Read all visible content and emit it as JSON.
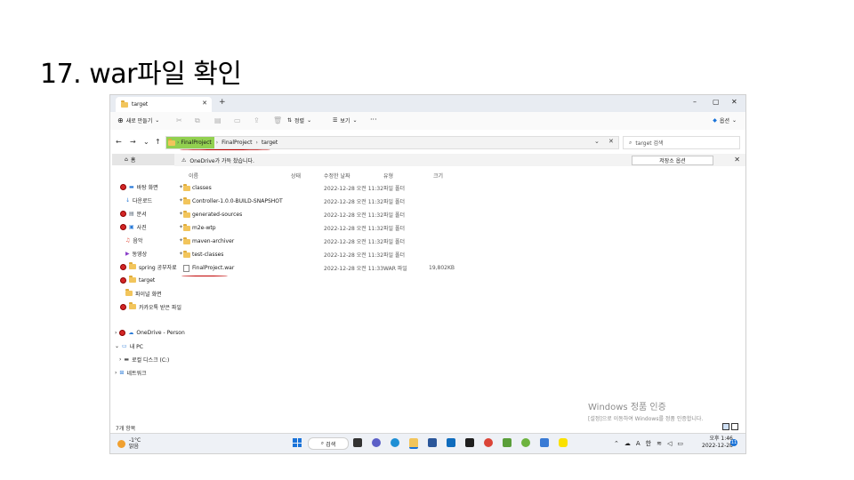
{
  "slide": {
    "title": "17. war파일 확인"
  },
  "window": {
    "tab_title": "target",
    "controls": {
      "minimize": "–",
      "maximize": "▢",
      "close": "✕"
    }
  },
  "toolbar": {
    "new_label": "새로 만들기",
    "sort_label": "정렬",
    "view_label": "보기",
    "more_label": "···",
    "options_label": "옵션"
  },
  "address": {
    "crumbs": [
      "FinalProject",
      "FinalProject",
      "target"
    ],
    "search_placeholder": "target 검색"
  },
  "sidebar": {
    "home": "홈",
    "pinned": [
      {
        "label": "바탕 화면",
        "icon": "desktop-icon"
      },
      {
        "label": "다운로드",
        "icon": "download-icon"
      },
      {
        "label": "문서",
        "icon": "document-icon"
      },
      {
        "label": "사진",
        "icon": "picture-icon"
      },
      {
        "label": "음악",
        "icon": "music-icon"
      },
      {
        "label": "동영상",
        "icon": "video-icon"
      },
      {
        "label": "spring 공부자료",
        "icon": "folder-icon"
      },
      {
        "label": "target",
        "icon": "folder-icon"
      },
      {
        "label": "파이널 화면",
        "icon": "folder-icon"
      },
      {
        "label": "카카오톡 받은 파일",
        "icon": "folder-icon"
      }
    ],
    "tree": [
      {
        "label": "OneDrive - Person"
      },
      {
        "label": "내 PC"
      },
      {
        "label": "로컬 디스크 (C:)"
      },
      {
        "label": "네트워크"
      }
    ]
  },
  "onedrive_bar": {
    "message": "OneDrive가 가득 찼습니다.",
    "button": "저장소 옵션"
  },
  "columns": {
    "name": "이름",
    "status": "상태",
    "modified": "수정한 날짜",
    "type": "유형",
    "size": "크기"
  },
  "files": [
    {
      "name": "classes",
      "date": "2022-12-28 오전 11:32",
      "type": "파일 폴더",
      "size": "",
      "kind": "folder"
    },
    {
      "name": "Controller-1.0.0-BUILD-SNAPSHOT",
      "date": "2022-12-28 오전 11:32",
      "type": "파일 폴더",
      "size": "",
      "kind": "folder"
    },
    {
      "name": "generated-sources",
      "date": "2022-12-28 오전 11:32",
      "type": "파일 폴더",
      "size": "",
      "kind": "folder"
    },
    {
      "name": "m2e-wtp",
      "date": "2022-12-28 오전 11:32",
      "type": "파일 폴더",
      "size": "",
      "kind": "folder"
    },
    {
      "name": "maven-archiver",
      "date": "2022-12-28 오전 11:32",
      "type": "파일 폴더",
      "size": "",
      "kind": "folder"
    },
    {
      "name": "test-classes",
      "date": "2022-12-28 오전 11:32",
      "type": "파일 폴더",
      "size": "",
      "kind": "folder"
    },
    {
      "name": "FinalProject.war",
      "date": "2022-12-28 오전 11:33",
      "type": "WAR 파일",
      "size": "19,802KB",
      "kind": "file"
    }
  ],
  "status_bar": {
    "item_count": "7개 항목"
  },
  "watermark": {
    "line1": "Windows 정품 인증",
    "line2": "[설정]으로 이동하여 Windows를 정품 인증합니다."
  },
  "taskbar": {
    "temperature": "-1°C",
    "weather": "맑음",
    "search_label": "검색",
    "ime": "한",
    "ime_mode": "A",
    "time": "오후 1:46",
    "date": "2022-12-28",
    "notifications": "11"
  },
  "colors": {
    "accent": "#1a73d9",
    "highlight": "#92d050",
    "annotation": "#c00000",
    "folder": "#f2c55c"
  }
}
